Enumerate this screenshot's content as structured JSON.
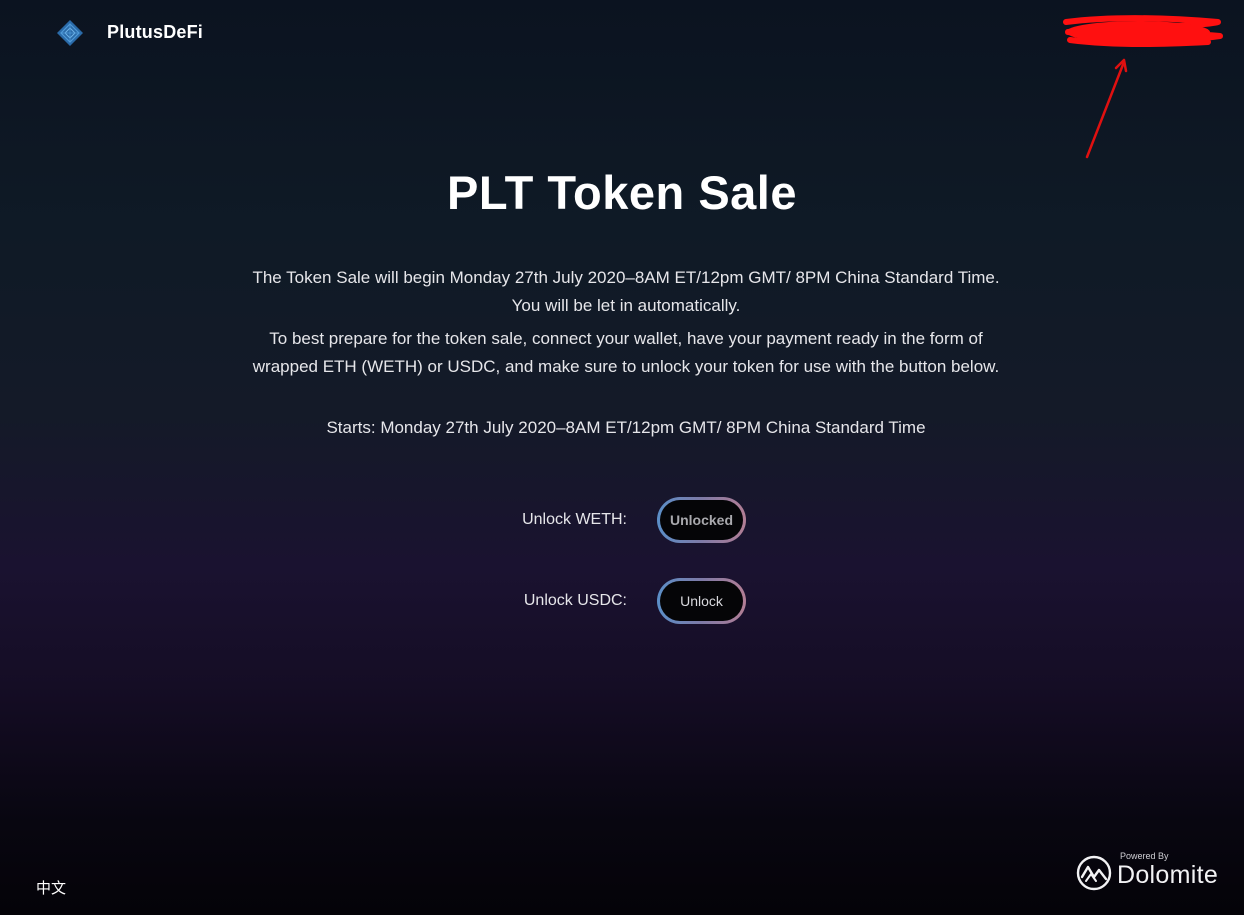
{
  "header": {
    "brand_name": "PlutusDeFi",
    "logo_icon": "plutus-diamond-logo-icon"
  },
  "main": {
    "title": "PLT Token Sale",
    "paragraphs": [
      "The Token Sale will begin Monday 27th July 2020–8AM ET/12pm GMT/ 8PM China Standard Time. You will be let in automatically.",
      "To best prepare for the token sale, connect your wallet, have your payment ready in the form of wrapped ETH (WETH) or USDC, and make sure to unlock your token for use with the button below.",
      "Starts: Monday 27th July 2020–8AM ET/12pm GMT/ 8PM China Standard Time"
    ],
    "unlock_rows": [
      {
        "label": "Unlock WETH:",
        "button": "Unlocked"
      },
      {
        "label": "Unlock USDC:",
        "button": "Unlock"
      }
    ]
  },
  "footer": {
    "language_toggle": "中文",
    "powered_by": "Powered By",
    "provider": "Dolomite"
  },
  "colors": {
    "accent_gradient_start": "#5b8fc8",
    "accent_gradient_end": "#b27e95",
    "redaction_and_arrow": "#ff0000"
  }
}
